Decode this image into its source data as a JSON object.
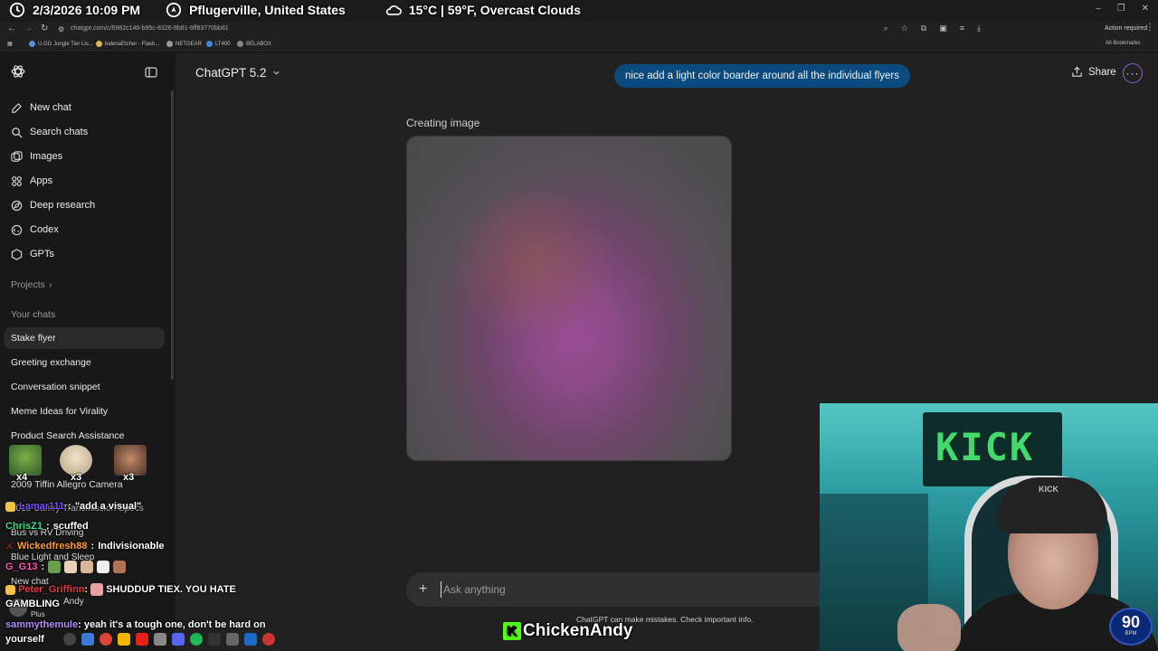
{
  "overlay": {
    "datetime": "2/3/2026 10:09 PM",
    "location": "Pflugerville, United States",
    "weather": "15°C | 59°F, Overcast Clouds"
  },
  "browser": {
    "url": "chatgpt.com/c/6982c146-b95c-8326-8b81-9ff83770bb81",
    "action_required": "Action required",
    "bookmarks": [
      "U.GG Jungle Tier Lis...",
      "balenaEtcher - Flash...",
      "NETGEAR",
      "LT400",
      "BELABOX"
    ],
    "all_bookmarks": "All Bookmarks"
  },
  "sidebar": {
    "nav": [
      {
        "label": "New chat",
        "icon": "edit-icon"
      },
      {
        "label": "Search chats",
        "icon": "search-icon"
      },
      {
        "label": "Images",
        "icon": "images-icon"
      },
      {
        "label": "Apps",
        "icon": "apps-icon"
      },
      {
        "label": "Deep research",
        "icon": "deep-research-icon"
      },
      {
        "label": "Codex",
        "icon": "codex-icon"
      },
      {
        "label": "GPTs",
        "icon": "gpts-icon"
      }
    ],
    "projects_label": "Projects",
    "your_chats_label": "Your chats",
    "chats": [
      "Stake flyer",
      "Greeting exchange",
      "Conversation snippet",
      "Meme Ideas for Virality",
      "Product Search Assistance",
      "2009 Tiffin Allegro Camera",
      "2013 Camry Transmission Specs",
      "Bus vs RV Driving",
      "Blue Light and Sleep"
    ],
    "footer_user": "Andy",
    "footer_plan": "Plus",
    "footer_new_chat": "New chat"
  },
  "main": {
    "model_label": "ChatGPT 5.2",
    "user_message": "nice add a light color boarder around all the individual flyers",
    "share_label": "Share",
    "creating_label": "Creating image",
    "composer_placeholder": "Ask anything",
    "disclaimer": "ChatGPT can make mistakes. Check important info."
  },
  "stream": {
    "channel": "ChickenAndy",
    "bpm_value": "90",
    "bpm_unit": "BPM",
    "emote_counts": [
      "x4",
      "x3",
      "x3"
    ],
    "chat": [
      {
        "user": "Lamar111",
        "msg": "\"add a visual\"",
        "color": "#7b4cff"
      },
      {
        "user": "ChrisZ1",
        "msg": "scuffed",
        "color": "#3ddc84"
      },
      {
        "user": "Wickedfresh88",
        "msg": "Indivisionable",
        "color": "#ff9a2e"
      },
      {
        "user": "G_G13",
        "msg": "",
        "color": "#ff5ab0"
      },
      {
        "user": "Peter_Griffinn",
        "msg": "SHUDDUP TIEX. YOU HATE GAMBLING",
        "color": "#e33b3b"
      },
      {
        "user": "sammythemule",
        "msg": "yeah it's a tough one, don't be hard on yourself",
        "color": "#b28cff"
      }
    ]
  },
  "colors": {
    "sidebar_bg": "#181818",
    "main_bg": "#212121",
    "user_bubble": "#0b4a7e",
    "kick_green": "#53fc18"
  }
}
